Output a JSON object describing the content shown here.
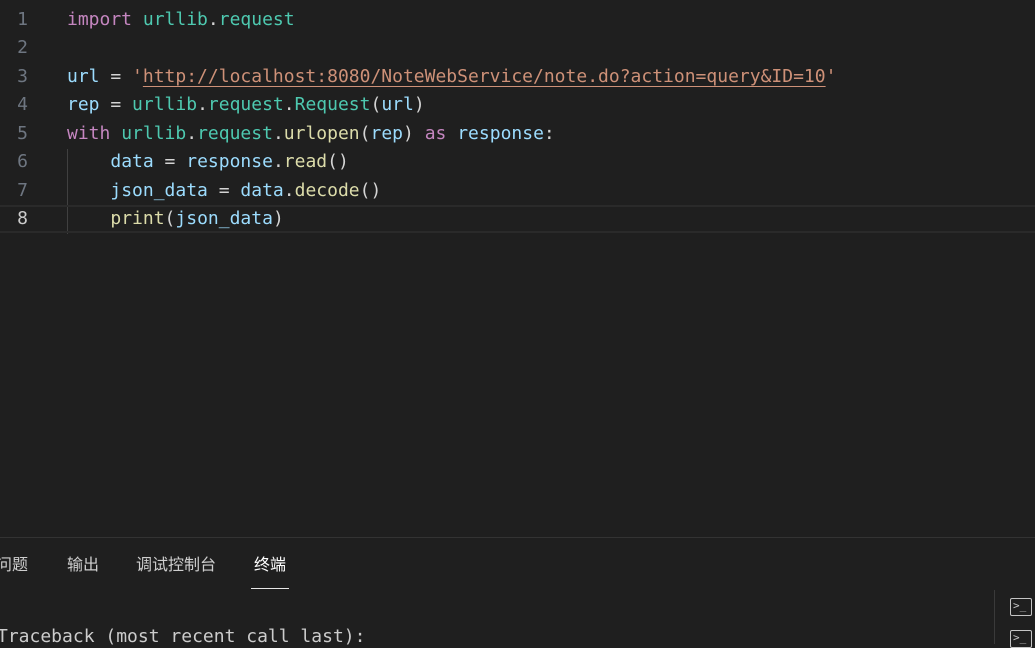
{
  "editor": {
    "lines": [
      {
        "num": "1",
        "tokens": [
          {
            "t": "import",
            "c": "kw"
          },
          {
            "t": " ",
            "c": "op"
          },
          {
            "t": "urllib",
            "c": "mod"
          },
          {
            "t": ".",
            "c": "op"
          },
          {
            "t": "request",
            "c": "mod"
          }
        ]
      },
      {
        "num": "2",
        "tokens": []
      },
      {
        "num": "3",
        "tokens": [
          {
            "t": "url",
            "c": "var"
          },
          {
            "t": " = ",
            "c": "op"
          },
          {
            "t": "'",
            "c": "str"
          },
          {
            "t": "http://localhost:8080/NoteWebService/note.do?action=query&ID=10",
            "c": "url"
          },
          {
            "t": "'",
            "c": "str"
          }
        ]
      },
      {
        "num": "4",
        "tokens": [
          {
            "t": "rep",
            "c": "var"
          },
          {
            "t": " = ",
            "c": "op"
          },
          {
            "t": "urllib",
            "c": "mod"
          },
          {
            "t": ".",
            "c": "op"
          },
          {
            "t": "request",
            "c": "mod"
          },
          {
            "t": ".",
            "c": "op"
          },
          {
            "t": "Request",
            "c": "mod"
          },
          {
            "t": "(",
            "c": "op"
          },
          {
            "t": "url",
            "c": "var"
          },
          {
            "t": ")",
            "c": "op"
          }
        ]
      },
      {
        "num": "5",
        "tokens": [
          {
            "t": "with",
            "c": "kw"
          },
          {
            "t": " ",
            "c": "op"
          },
          {
            "t": "urllib",
            "c": "mod"
          },
          {
            "t": ".",
            "c": "op"
          },
          {
            "t": "request",
            "c": "mod"
          },
          {
            "t": ".",
            "c": "op"
          },
          {
            "t": "urlopen",
            "c": "fn"
          },
          {
            "t": "(",
            "c": "op"
          },
          {
            "t": "rep",
            "c": "var"
          },
          {
            "t": ") ",
            "c": "op"
          },
          {
            "t": "as",
            "c": "kw"
          },
          {
            "t": " ",
            "c": "op"
          },
          {
            "t": "response",
            "c": "var"
          },
          {
            "t": ":",
            "c": "op"
          }
        ]
      },
      {
        "num": "6",
        "tokens": [
          {
            "t": "    ",
            "c": "op"
          },
          {
            "t": "data",
            "c": "var"
          },
          {
            "t": " = ",
            "c": "op"
          },
          {
            "t": "response",
            "c": "var"
          },
          {
            "t": ".",
            "c": "op"
          },
          {
            "t": "read",
            "c": "fn"
          },
          {
            "t": "()",
            "c": "op"
          }
        ]
      },
      {
        "num": "7",
        "tokens": [
          {
            "t": "    ",
            "c": "op"
          },
          {
            "t": "json_data",
            "c": "var"
          },
          {
            "t": " = ",
            "c": "op"
          },
          {
            "t": "data",
            "c": "var"
          },
          {
            "t": ".",
            "c": "op"
          },
          {
            "t": "decode",
            "c": "fn"
          },
          {
            "t": "()",
            "c": "op"
          }
        ]
      },
      {
        "num": "8",
        "current": true,
        "tokens": [
          {
            "t": "    ",
            "c": "op"
          },
          {
            "t": "print",
            "c": "fn"
          },
          {
            "t": "(",
            "c": "op"
          },
          {
            "t": "json_data",
            "c": "var"
          },
          {
            "t": ")",
            "c": "op"
          }
        ]
      }
    ]
  },
  "panel": {
    "tabs": [
      {
        "label": "问题",
        "active": false
      },
      {
        "label": "输出",
        "active": false
      },
      {
        "label": "调试控制台",
        "active": false
      },
      {
        "label": "终端",
        "active": true
      }
    ],
    "terminal_text": "Traceback (most recent call last):",
    "icons": [
      "terminal-icon",
      "terminal-icon"
    ]
  }
}
